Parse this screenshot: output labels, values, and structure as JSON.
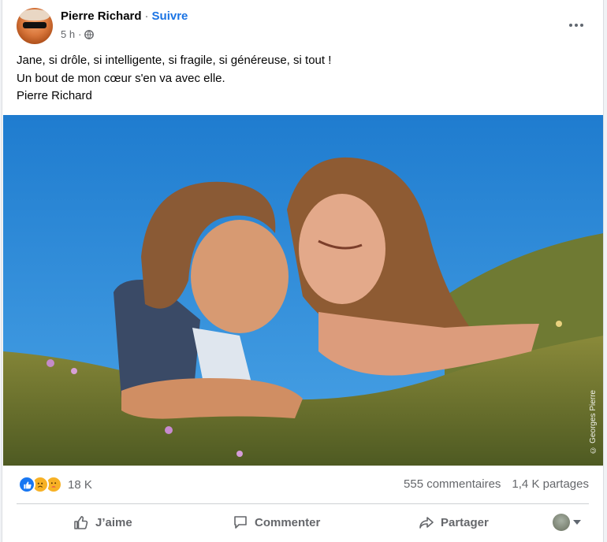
{
  "post": {
    "author": "Pierre Richard",
    "separator": "·",
    "follow_label": "Suivre",
    "time": "5 h",
    "privacy_icon": "globe-icon",
    "more_icon": "more-options-icon",
    "text_lines": [
      "Jane, si drôle, si intelligente, si fragile, si généreuse, si tout !",
      "Un bout de mon cœur s'en va avec elle.",
      "Pierre Richard"
    ],
    "photo_credit": "© Georges Pierre"
  },
  "stats": {
    "reaction_icons": [
      "like-reaction-icon",
      "sad-reaction-icon",
      "care-reaction-icon"
    ],
    "reaction_count": "18 K",
    "comments": "555 commentaires",
    "shares": "1,4 K partages"
  },
  "actions": {
    "like": "J’aime",
    "comment": "Commenter",
    "share": "Partager"
  },
  "colors": {
    "accent": "#1b74e4",
    "muted": "#65676b",
    "sky": "#2a89d6"
  }
}
